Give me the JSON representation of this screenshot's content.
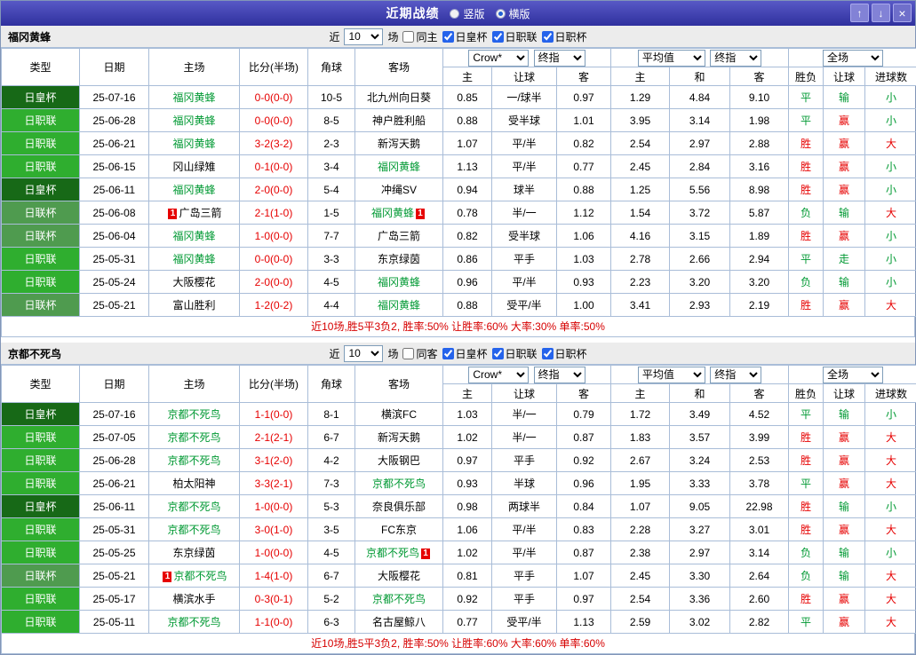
{
  "colors": {
    "titlebar-start": "#5859c6",
    "titlebar-end": "#2f309e",
    "border": "#a9bdd8",
    "league-emperor": "#176917",
    "league-j1": "#2fae2f",
    "league-lcup": "#4f9b4f",
    "self-team": "#009933",
    "score": "#e60000",
    "win": "#e60000",
    "lose": "#009933",
    "summary": "#d60000",
    "badge": "#e60000"
  },
  "win_values": [
    "胜",
    "赢",
    "大"
  ],
  "titlebar": {
    "title": "近期战绩",
    "layout_options": [
      {
        "label": "竖版",
        "selected": false
      },
      {
        "label": "横版",
        "selected": true
      }
    ],
    "buttons": {
      "up": "↑",
      "down": "↓",
      "close": "×"
    }
  },
  "table_header": {
    "type": "类型",
    "date": "日期",
    "home": "主场",
    "score": "比分(半场)",
    "corner": "角球",
    "away": "客场",
    "crown_select": "Crow*",
    "final_select": "终指",
    "avg_select": "平均值",
    "final_select2": "终指",
    "scope_select": "全场",
    "sub": [
      "主",
      "让球",
      "客",
      "主",
      "和",
      "客",
      "胜负",
      "让球",
      "进球数"
    ]
  },
  "sections": [
    {
      "team": "福冈黄蜂",
      "filter": {
        "near_label": "近",
        "count": "10",
        "games_label": "场",
        "same_label": "同主",
        "same_checked": false,
        "cups": [
          {
            "label": "日皇杯",
            "checked": true
          },
          {
            "label": "日职联",
            "checked": true
          },
          {
            "label": "日职杯",
            "checked": true
          }
        ]
      },
      "rows": [
        {
          "league": "日皇杯",
          "date": "25-07-16",
          "home": "福冈黄蜂",
          "home_self": true,
          "home_badge": "",
          "score": "0-0(0-0)",
          "corner": "10-5",
          "away": "北九州向日葵",
          "away_self": false,
          "away_badge": "",
          "crown": [
            "0.85",
            "一/球半",
            "0.97"
          ],
          "avg": [
            "1.29",
            "4.84",
            "9.10"
          ],
          "full": [
            "平",
            "输",
            "小"
          ]
        },
        {
          "league": "日职联",
          "date": "25-06-28",
          "home": "福冈黄蜂",
          "home_self": true,
          "home_badge": "",
          "score": "0-0(0-0)",
          "corner": "8-5",
          "away": "神户胜利船",
          "away_self": false,
          "away_badge": "",
          "crown": [
            "0.88",
            "受半球",
            "1.01"
          ],
          "avg": [
            "3.95",
            "3.14",
            "1.98"
          ],
          "full": [
            "平",
            "赢",
            "小"
          ]
        },
        {
          "league": "日职联",
          "date": "25-06-21",
          "home": "福冈黄蜂",
          "home_self": true,
          "home_badge": "",
          "score": "3-2(3-2)",
          "corner": "2-3",
          "away": "新泻天鹅",
          "away_self": false,
          "away_badge": "",
          "crown": [
            "1.07",
            "平/半",
            "0.82"
          ],
          "avg": [
            "2.54",
            "2.97",
            "2.88"
          ],
          "full": [
            "胜",
            "赢",
            "大"
          ]
        },
        {
          "league": "日职联",
          "date": "25-06-15",
          "home": "冈山绿雉",
          "home_self": false,
          "home_badge": "",
          "score": "0-1(0-0)",
          "corner": "3-4",
          "away": "福冈黄蜂",
          "away_self": true,
          "away_badge": "",
          "crown": [
            "1.13",
            "平/半",
            "0.77"
          ],
          "avg": [
            "2.45",
            "2.84",
            "3.16"
          ],
          "full": [
            "胜",
            "赢",
            "小"
          ]
        },
        {
          "league": "日皇杯",
          "date": "25-06-11",
          "home": "福冈黄蜂",
          "home_self": true,
          "home_badge": "",
          "score": "2-0(0-0)",
          "corner": "5-4",
          "away": "冲绳SV",
          "away_self": false,
          "away_badge": "",
          "crown": [
            "0.94",
            "球半",
            "0.88"
          ],
          "avg": [
            "1.25",
            "5.56",
            "8.98"
          ],
          "full": [
            "胜",
            "赢",
            "小"
          ]
        },
        {
          "league": "日联杯",
          "date": "25-06-08",
          "home": "广岛三箭",
          "home_self": false,
          "home_badge": "1",
          "score": "2-1(1-0)",
          "corner": "1-5",
          "away": "福冈黄蜂",
          "away_self": true,
          "away_badge": "1",
          "crown": [
            "0.78",
            "半/一",
            "1.12"
          ],
          "avg": [
            "1.54",
            "3.72",
            "5.87"
          ],
          "full": [
            "负",
            "输",
            "大"
          ]
        },
        {
          "league": "日联杯",
          "date": "25-06-04",
          "home": "福冈黄蜂",
          "home_self": true,
          "home_badge": "",
          "score": "1-0(0-0)",
          "corner": "7-7",
          "away": "广岛三箭",
          "away_self": false,
          "away_badge": "",
          "crown": [
            "0.82",
            "受半球",
            "1.06"
          ],
          "avg": [
            "4.16",
            "3.15",
            "1.89"
          ],
          "full": [
            "胜",
            "赢",
            "小"
          ]
        },
        {
          "league": "日职联",
          "date": "25-05-31",
          "home": "福冈黄蜂",
          "home_self": true,
          "home_badge": "",
          "score": "0-0(0-0)",
          "corner": "3-3",
          "away": "东京绿茵",
          "away_self": false,
          "away_badge": "",
          "crown": [
            "0.86",
            "平手",
            "1.03"
          ],
          "avg": [
            "2.78",
            "2.66",
            "2.94"
          ],
          "full": [
            "平",
            "走",
            "小"
          ]
        },
        {
          "league": "日职联",
          "date": "25-05-24",
          "home": "大阪樱花",
          "home_self": false,
          "home_badge": "",
          "score": "2-0(0-0)",
          "corner": "4-5",
          "away": "福冈黄蜂",
          "away_self": true,
          "away_badge": "",
          "crown": [
            "0.96",
            "平/半",
            "0.93"
          ],
          "avg": [
            "2.23",
            "3.20",
            "3.20"
          ],
          "full": [
            "负",
            "输",
            "小"
          ]
        },
        {
          "league": "日联杯",
          "date": "25-05-21",
          "home": "富山胜利",
          "home_self": false,
          "home_badge": "",
          "score": "1-2(0-2)",
          "corner": "4-4",
          "away": "福冈黄蜂",
          "away_self": true,
          "away_badge": "",
          "crown": [
            "0.88",
            "受平/半",
            "1.00"
          ],
          "avg": [
            "3.41",
            "2.93",
            "2.19"
          ],
          "full": [
            "胜",
            "赢",
            "大"
          ]
        }
      ],
      "summary": "近10场,胜5平3负2, 胜率:50% 让胜率:60% 大率:30% 单率:50%"
    },
    {
      "team": "京都不死鸟",
      "filter": {
        "near_label": "近",
        "count": "10",
        "games_label": "场",
        "same_label": "同客",
        "same_checked": false,
        "cups": [
          {
            "label": "日皇杯",
            "checked": true
          },
          {
            "label": "日职联",
            "checked": true
          },
          {
            "label": "日职杯",
            "checked": true
          }
        ]
      },
      "rows": [
        {
          "league": "日皇杯",
          "date": "25-07-16",
          "home": "京都不死鸟",
          "home_self": true,
          "home_badge": "",
          "score": "1-1(0-0)",
          "corner": "8-1",
          "away": "横滨FC",
          "away_self": false,
          "away_badge": "",
          "crown": [
            "1.03",
            "半/一",
            "0.79"
          ],
          "avg": [
            "1.72",
            "3.49",
            "4.52"
          ],
          "full": [
            "平",
            "输",
            "小"
          ]
        },
        {
          "league": "日职联",
          "date": "25-07-05",
          "home": "京都不死鸟",
          "home_self": true,
          "home_badge": "",
          "score": "2-1(2-1)",
          "corner": "6-7",
          "away": "新泻天鹅",
          "away_self": false,
          "away_badge": "",
          "crown": [
            "1.02",
            "半/一",
            "0.87"
          ],
          "avg": [
            "1.83",
            "3.57",
            "3.99"
          ],
          "full": [
            "胜",
            "赢",
            "大"
          ]
        },
        {
          "league": "日职联",
          "date": "25-06-28",
          "home": "京都不死鸟",
          "home_self": true,
          "home_badge": "",
          "score": "3-1(2-0)",
          "corner": "4-2",
          "away": "大阪钢巴",
          "away_self": false,
          "away_badge": "",
          "crown": [
            "0.97",
            "平手",
            "0.92"
          ],
          "avg": [
            "2.67",
            "3.24",
            "2.53"
          ],
          "full": [
            "胜",
            "赢",
            "大"
          ]
        },
        {
          "league": "日职联",
          "date": "25-06-21",
          "home": "柏太阳神",
          "home_self": false,
          "home_badge": "",
          "score": "3-3(2-1)",
          "corner": "7-3",
          "away": "京都不死鸟",
          "away_self": true,
          "away_badge": "",
          "crown": [
            "0.93",
            "半球",
            "0.96"
          ],
          "avg": [
            "1.95",
            "3.33",
            "3.78"
          ],
          "full": [
            "平",
            "赢",
            "大"
          ]
        },
        {
          "league": "日皇杯",
          "date": "25-06-11",
          "home": "京都不死鸟",
          "home_self": true,
          "home_badge": "",
          "score": "1-0(0-0)",
          "corner": "5-3",
          "away": "奈良俱乐部",
          "away_self": false,
          "away_badge": "",
          "crown": [
            "0.98",
            "两球半",
            "0.84"
          ],
          "avg": [
            "1.07",
            "9.05",
            "22.98"
          ],
          "full": [
            "胜",
            "输",
            "小"
          ]
        },
        {
          "league": "日职联",
          "date": "25-05-31",
          "home": "京都不死鸟",
          "home_self": true,
          "home_badge": "",
          "score": "3-0(1-0)",
          "corner": "3-5",
          "away": "FC东京",
          "away_self": false,
          "away_badge": "",
          "crown": [
            "1.06",
            "平/半",
            "0.83"
          ],
          "avg": [
            "2.28",
            "3.27",
            "3.01"
          ],
          "full": [
            "胜",
            "赢",
            "大"
          ]
        },
        {
          "league": "日职联",
          "date": "25-05-25",
          "home": "东京绿茵",
          "home_self": false,
          "home_badge": "",
          "score": "1-0(0-0)",
          "corner": "4-5",
          "away": "京都不死鸟",
          "away_self": true,
          "away_badge": "1",
          "crown": [
            "1.02",
            "平/半",
            "0.87"
          ],
          "avg": [
            "2.38",
            "2.97",
            "3.14"
          ],
          "full": [
            "负",
            "输",
            "小"
          ]
        },
        {
          "league": "日联杯",
          "date": "25-05-21",
          "home": "京都不死鸟",
          "home_self": true,
          "home_badge": "1",
          "score": "1-4(1-0)",
          "corner": "6-7",
          "away": "大阪樱花",
          "away_self": false,
          "away_badge": "",
          "crown": [
            "0.81",
            "平手",
            "1.07"
          ],
          "avg": [
            "2.45",
            "3.30",
            "2.64"
          ],
          "full": [
            "负",
            "输",
            "大"
          ]
        },
        {
          "league": "日职联",
          "date": "25-05-17",
          "home": "横滨水手",
          "home_self": false,
          "home_badge": "",
          "score": "0-3(0-1)",
          "corner": "5-2",
          "away": "京都不死鸟",
          "away_self": true,
          "away_badge": "",
          "crown": [
            "0.92",
            "平手",
            "0.97"
          ],
          "avg": [
            "2.54",
            "3.36",
            "2.60"
          ],
          "full": [
            "胜",
            "赢",
            "大"
          ]
        },
        {
          "league": "日职联",
          "date": "25-05-11",
          "home": "京都不死鸟",
          "home_self": true,
          "home_badge": "",
          "score": "1-1(0-0)",
          "corner": "6-3",
          "away": "名古屋鲸八",
          "away_self": false,
          "away_badge": "",
          "crown": [
            "0.77",
            "受平/半",
            "1.13"
          ],
          "avg": [
            "2.59",
            "3.02",
            "2.82"
          ],
          "full": [
            "平",
            "赢",
            "大"
          ]
        }
      ],
      "summary": "近10场,胜5平3负2, 胜率:50% 让胜率:60% 大率:60% 单率:60%"
    }
  ]
}
